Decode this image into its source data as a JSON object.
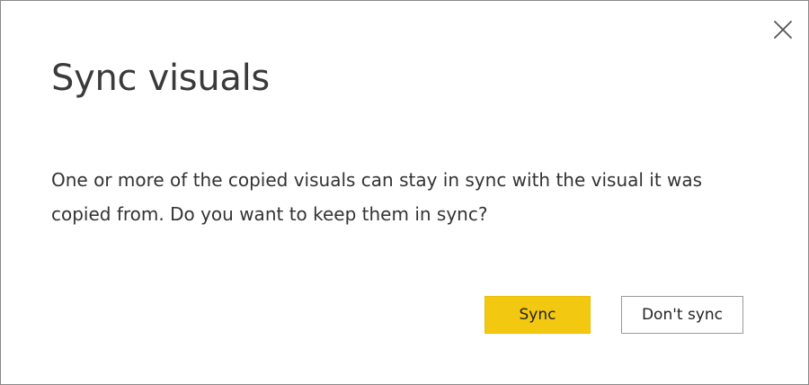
{
  "dialog": {
    "title": "Sync visuals",
    "message": "One or more of the copied visuals can stay in sync with the visual it was copied from. Do you want to keep them in sync?",
    "close_icon": "close-icon",
    "buttons": {
      "primary_label": "Sync",
      "secondary_label": "Don't sync"
    },
    "colors": {
      "primary_button": "#f2c811",
      "title_text": "#3a3a3a",
      "body_text": "#333333",
      "border": "#8a8a8a"
    }
  }
}
